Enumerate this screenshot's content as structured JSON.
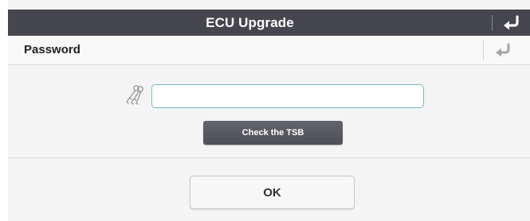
{
  "window": {
    "title": "ECU Upgrade",
    "back_icon": "return-arrow-icon"
  },
  "subheader": {
    "label": "Password",
    "back_icon": "return-arrow-icon"
  },
  "form": {
    "key_icon": "keys-icon",
    "password_value": "",
    "password_placeholder": "",
    "check_tsb_label": "Check the TSB"
  },
  "footer": {
    "ok_label": "OK"
  },
  "colors": {
    "titlebar_bg": "#46474e",
    "input_border": "#7fb7c4",
    "dark_button_bg": "#55565d"
  }
}
